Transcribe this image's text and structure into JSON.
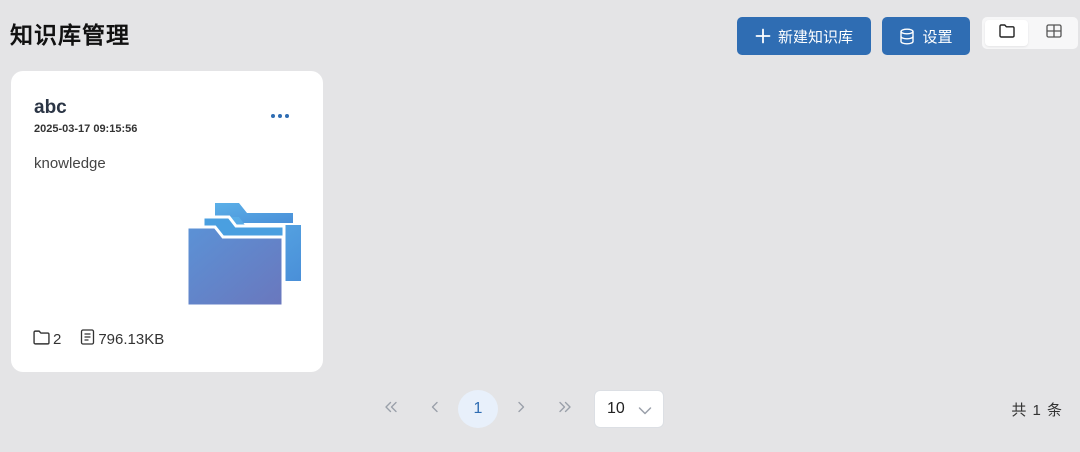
{
  "page": {
    "title": "知识库管理"
  },
  "toolbar": {
    "new_label": "新建知识库",
    "new_icon": "plus-icon",
    "settings_label": "设置",
    "settings_icon": "database-icon",
    "view_modes": [
      {
        "icon": "folder-icon",
        "active": true
      },
      {
        "icon": "grid-icon",
        "active": false
      }
    ]
  },
  "knowledge_bases": [
    {
      "name": "abc",
      "created": "2025-03-17 09:15:56",
      "description": "knowledge",
      "file_count": "2",
      "size": "796.13KB",
      "menu_icon": "more-icon",
      "illustration": "folders-icon"
    }
  ],
  "pagination": {
    "first_icon": "double-chevron-left-icon",
    "prev_icon": "chevron-left-icon",
    "current_page": "1",
    "next_icon": "chevron-right-icon",
    "last_icon": "double-chevron-right-icon",
    "page_size": "10",
    "total_text": "共 1 条"
  },
  "colors": {
    "accent": "#2f6db3",
    "background": "#e4e4e6",
    "card": "#ffffff"
  }
}
